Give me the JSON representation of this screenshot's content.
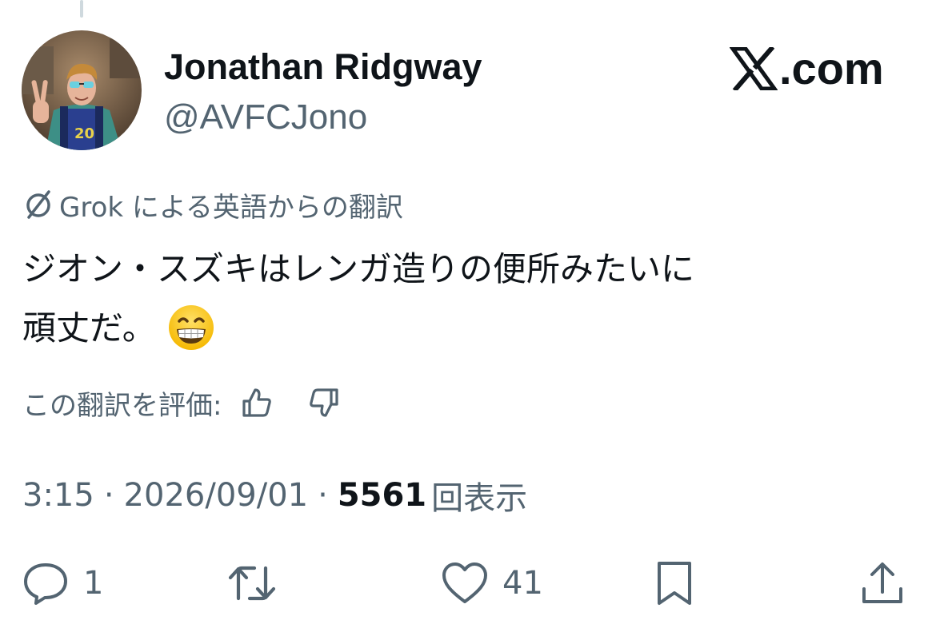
{
  "tweet": {
    "author_name": "Jonathan Ridgway",
    "author_handle": "@AVFCJono",
    "brand": ".com",
    "translation_label": "Grok による英語からの翻訳",
    "text_line_1": "ジオン・スズキはレンガ造りの便所みたいに",
    "text_line_2": "頑丈だ。",
    "emoji": "grinning-face-with-smiling-eyes",
    "rate_label": "この翻訳を評価:",
    "time": "3:15",
    "separator": "·",
    "date": "2026/09/01",
    "views_count": "5561",
    "views_label": "回表示"
  },
  "actions": {
    "reply_count": "1",
    "retweet_count": "",
    "like_count": "41"
  },
  "colors": {
    "text_primary": "#0f1419",
    "text_secondary": "#536471",
    "thread_line": "#cfd9de"
  },
  "icons": [
    "x-logo-icon",
    "translate-slash-icon",
    "thumbs-up-icon",
    "thumbs-down-icon",
    "reply-icon",
    "retweet-icon",
    "like-icon",
    "bookmark-icon",
    "share-icon"
  ]
}
